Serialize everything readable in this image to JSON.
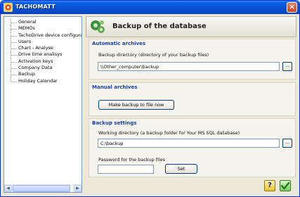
{
  "window": {
    "title": "TACHOMATT",
    "close": "×"
  },
  "sidebar": {
    "items": [
      {
        "label": "General"
      },
      {
        "label": "MEMOs"
      },
      {
        "label": "TachoDrive device configurat"
      },
      {
        "label": "Users"
      },
      {
        "label": "Chart - Analyse"
      },
      {
        "label": "Drive time analisys"
      },
      {
        "label": "Activation keys"
      },
      {
        "label": "Company Data"
      },
      {
        "label": "Backup"
      },
      {
        "label": "Holiday Calendar"
      }
    ],
    "scroll_left": "◀",
    "scroll_right": "▶"
  },
  "header": {
    "title": "Backup of the database"
  },
  "automatic": {
    "title": "Automatic archives",
    "dir_label": "Backup directory (directory of your backup files)",
    "dir_value": "\\\\Other_computer\\backup",
    "browse": "..."
  },
  "manual": {
    "title": "Manual archives",
    "button": "Make backup to file now"
  },
  "settings": {
    "title": "Backup settings",
    "workdir_label": "Working directory (a backup folder for Your MS SQL database)",
    "workdir_value": "C:\\backup",
    "browse": "...",
    "password_label": "Password for  the backup files",
    "password_value": "",
    "set_button": "Set"
  },
  "footer": {
    "help": "?"
  }
}
